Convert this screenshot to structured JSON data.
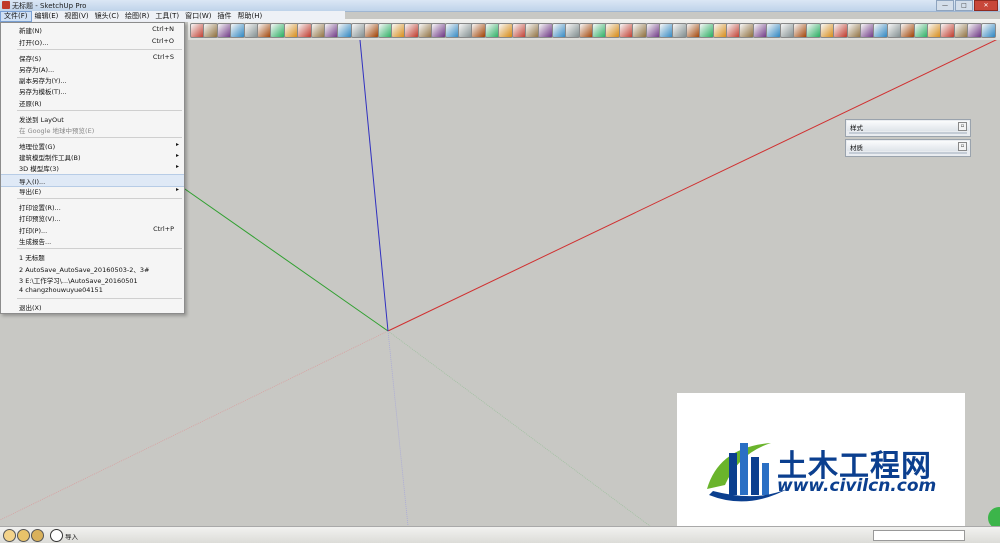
{
  "window": {
    "title": "无标题 - SketchUp Pro",
    "controls": [
      "—",
      "□",
      "✕"
    ]
  },
  "menubar": {
    "items": [
      "文件(F)",
      "编辑(E)",
      "视图(V)",
      "镜头(C)",
      "绘图(R)",
      "工具(T)",
      "窗口(W)",
      "插件",
      "帮助(H)"
    ]
  },
  "file_menu": {
    "new": {
      "label": "新建(N)",
      "shortcut": "Ctrl+N"
    },
    "open": {
      "label": "打开(O)...",
      "shortcut": "Ctrl+O"
    },
    "save": {
      "label": "保存(S)",
      "shortcut": "Ctrl+S"
    },
    "save_as": {
      "label": "另存为(A)..."
    },
    "save_copy_as": {
      "label": "副本另存为(Y)..."
    },
    "save_as_template": {
      "label": "另存为模板(T)..."
    },
    "revert": {
      "label": "还原(R)"
    },
    "send_to_layout": {
      "label": "发送到 LayOut"
    },
    "preview_google": {
      "label": "在 Google 地球中预览(E)"
    },
    "geo_location": {
      "label": "地理位置(G)"
    },
    "building_maker": {
      "label": "建筑模型制作工具(B)"
    },
    "warehouse_3d": {
      "label": "3D 模型库(3)"
    },
    "import": {
      "label": "导入(I)..."
    },
    "export": {
      "label": "导出(E)"
    },
    "print_setup": {
      "label": "打印设置(R)..."
    },
    "print_preview": {
      "label": "打印预览(V)..."
    },
    "print": {
      "label": "打印(P)...",
      "shortcut": "Ctrl+P"
    },
    "generate_report": {
      "label": "生成报告..."
    },
    "recent": [
      "1 无标题",
      "2 AutoSave_AutoSave_20160503-2、3#",
      "3 E:\\工作学习\\...\\AutoSave_20160501",
      "4 changzhouwuyue04151"
    ],
    "exit": {
      "label": "退出(X)"
    },
    "submenu_arrow": "▸"
  },
  "trays": {
    "styles": {
      "title": "样式",
      "close": "▫"
    },
    "materials": {
      "title": "材质",
      "close": "▫"
    }
  },
  "statusbar": {
    "text": "导入"
  },
  "watermark": {
    "cn": "土木工程网",
    "en": "www.civilcn.com"
  },
  "colors": {
    "axis_red": "#d03030",
    "axis_green": "#30a030",
    "axis_blue": "#3030c0",
    "viewport_bg": "#c8c8c4",
    "watermark_blue": "#0b3f8f",
    "watermark_green": "#6ab42c"
  }
}
